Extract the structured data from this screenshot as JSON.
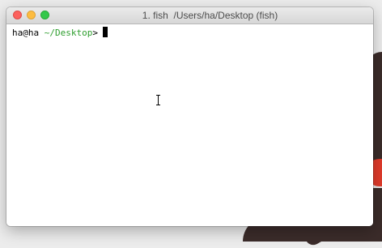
{
  "window": {
    "title": "1. fish  /Users/ha/Desktop (fish)"
  },
  "terminal": {
    "user_host": "ha@ha",
    "cwd": "~/Desktop",
    "prompt_symbol": ">",
    "input": ""
  },
  "colors": {
    "cwd": "#2e9e2e",
    "close": "#fc615d",
    "minimize": "#fdbc40",
    "maximize": "#34c84a"
  },
  "icons": {
    "mouse_pointer": "i-beam-cursor-icon"
  }
}
